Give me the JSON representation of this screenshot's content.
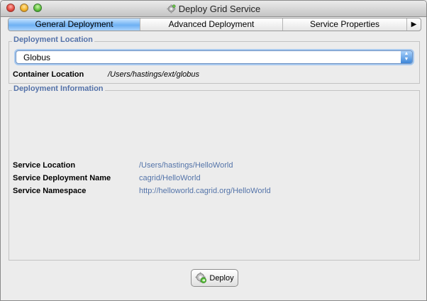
{
  "window": {
    "title": "Deploy Grid Service"
  },
  "tabs": [
    {
      "label": "General Deployment",
      "active": true
    },
    {
      "label": "Advanced Deployment",
      "active": false
    },
    {
      "label": "Service Properties",
      "active": false
    }
  ],
  "tab_overflow_icon": "right-triangle-icon",
  "deployment_location": {
    "legend": "Deployment Location",
    "container_type": "Globus",
    "container_location_label": "Container Location",
    "container_location_value": "/Users/hastings/ext/globus"
  },
  "deployment_information": {
    "legend": "Deployment Information",
    "service_location_label": "Service Location",
    "service_location_value": "/Users/hastings/HelloWorld",
    "service_deployment_name_label": "Service Deployment Name",
    "service_deployment_name_value": "cagrid/HelloWorld",
    "service_namespace_label": "Service Namespace",
    "service_namespace_value": "http://helloworld.cagrid.org/HelloWorld"
  },
  "actions": {
    "deploy_label": "Deploy"
  },
  "colors": {
    "legend": "#5472a9",
    "link": "#5474a9",
    "tab_active": "#6eb1f4"
  }
}
